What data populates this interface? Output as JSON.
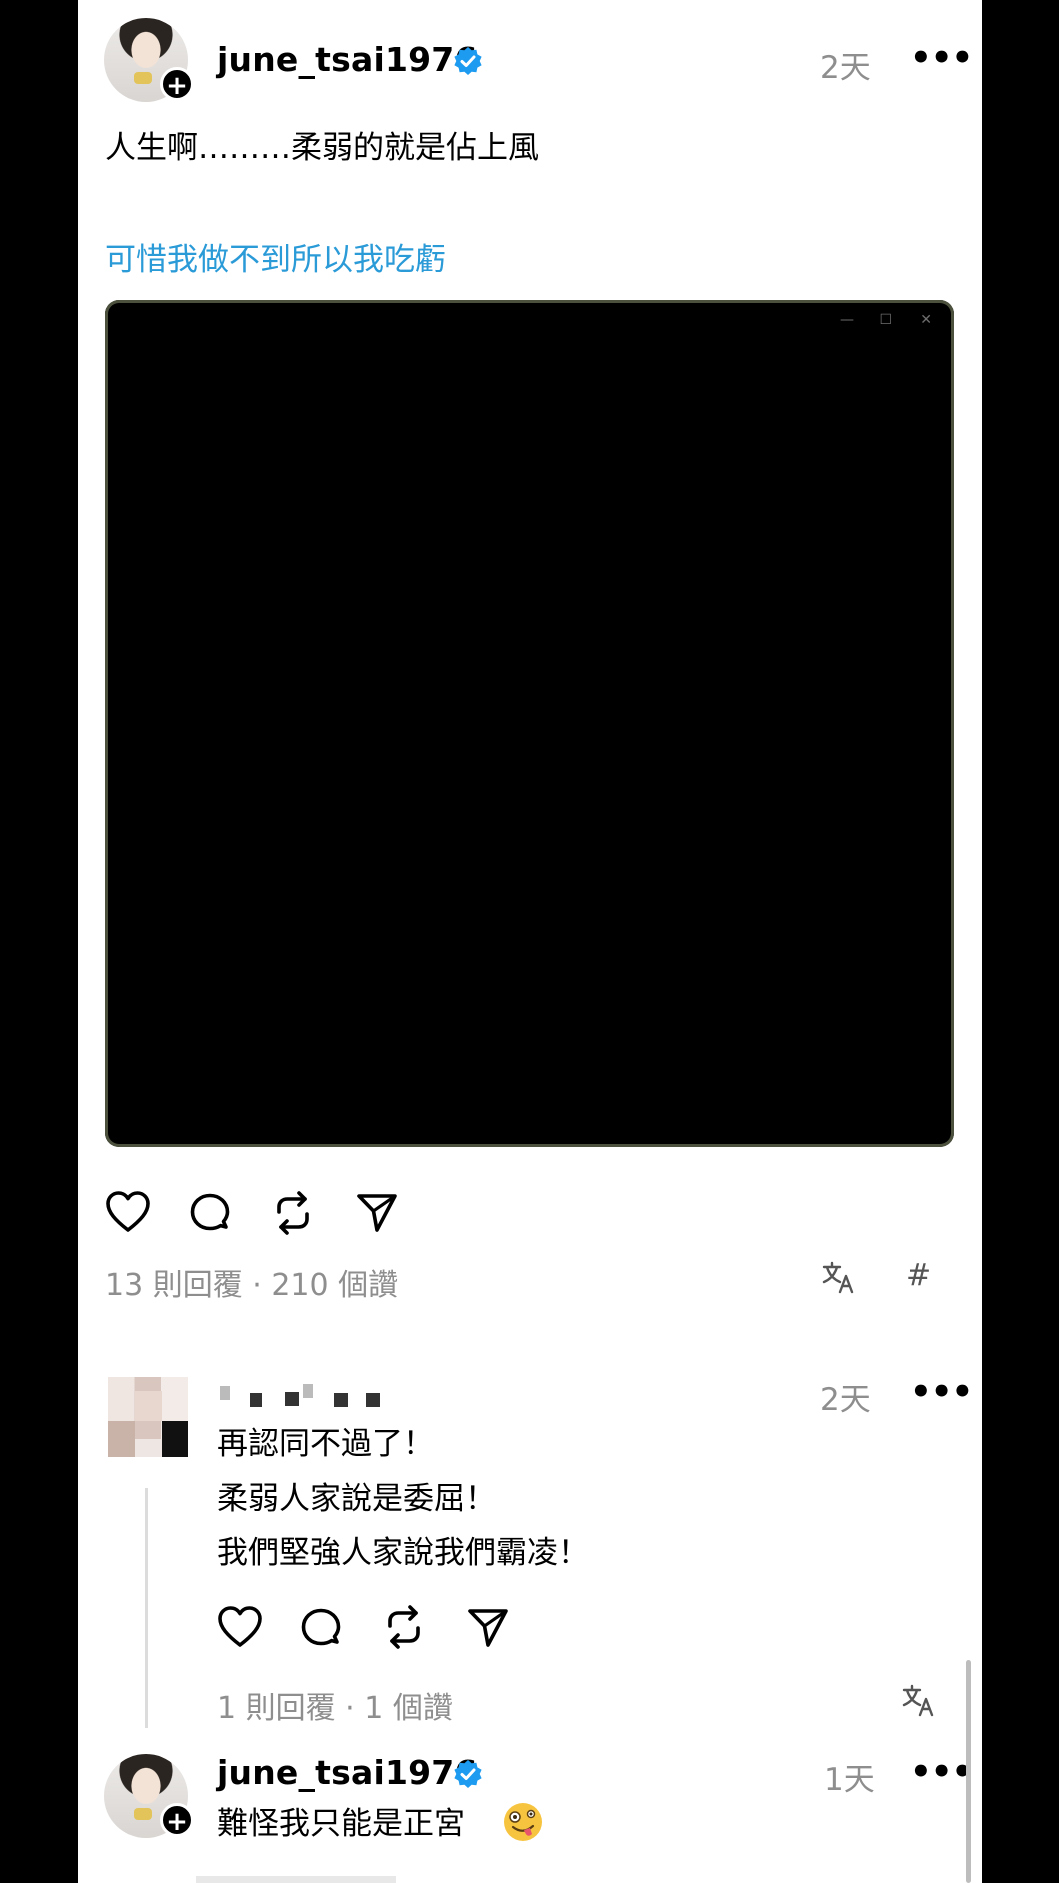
{
  "post": {
    "username": "june_tsai1976",
    "time": "2天",
    "more_icon": "more-horizontal-icon",
    "text": "人生啊………柔弱的就是佔上風",
    "link_text": "可惜我做不到所以我吃虧",
    "stats": "13 則回覆 · 210 個讚",
    "translate_icon": "translate-icon",
    "tag_icon": "#"
  },
  "reply": {
    "time": "2天",
    "lines": [
      "再認同不過了！",
      "柔弱人家說是委屈！",
      "我們堅強人家說我們霸凌！"
    ],
    "stats": "1 則回覆 · 1 個讚"
  },
  "reply2": {
    "username": "june_tsai1976",
    "time": "1天",
    "text": "難怪我只能是正宮",
    "emoji": "zany-face-emoji"
  },
  "colors": {
    "link": "#2b9bd8",
    "verified": "#1d9bf0",
    "muted": "#8e8e8e"
  }
}
